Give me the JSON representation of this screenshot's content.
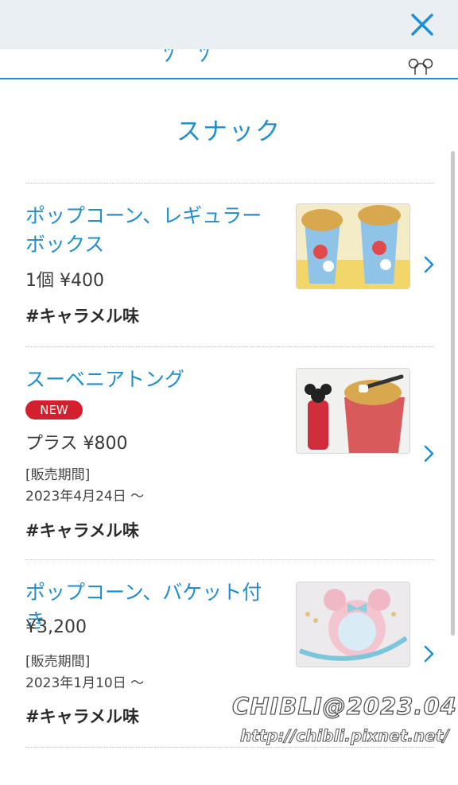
{
  "header": {
    "close_icon": "close-icon",
    "close_color": "#1f8fd2",
    "partial_title": "ﾂ ﾂ"
  },
  "section": {
    "title": "スナック"
  },
  "items": [
    {
      "name": "ポップコーン、レギュラーボックス",
      "price": "1個 ¥400",
      "tag": "#キャラメル味",
      "image": "popcorn-regular-box-photo"
    },
    {
      "name": "スーベニアトング",
      "badge": "NEW",
      "price": "プラス ¥800",
      "period_label": "[販売期間]",
      "period_value": "2023年4月24日 〜",
      "tag": "#キャラメル味",
      "image": "souvenir-tongs-photo"
    },
    {
      "name": "ポップコーン、バケット付き",
      "price": "¥3,200",
      "period_label": "[販売期間]",
      "period_value": "2023年1月10日 〜",
      "tag": "#キャラメル味",
      "image": "popcorn-bucket-photo"
    }
  ],
  "watermark": {
    "line1": "CHIBLI@2023.04",
    "line2": "http://chibli.pixnet.net/"
  },
  "colors": {
    "accent": "#1f8fd2",
    "badge": "#d4202e",
    "topbar": "#e9eff3"
  }
}
